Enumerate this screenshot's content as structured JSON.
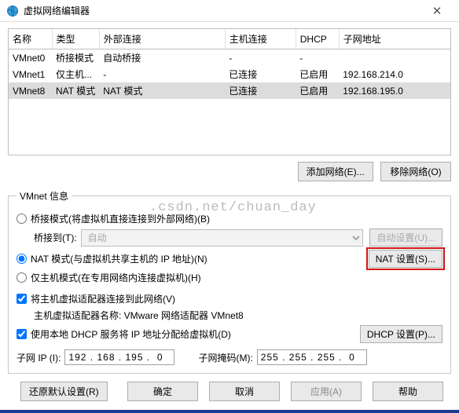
{
  "title": "虚拟网络编辑器",
  "close_icon": "✕",
  "globe_icon": "🌐",
  "watermark": ".csdn.net/chuan_day",
  "table": {
    "headers": [
      "名称",
      "类型",
      "外部连接",
      "主机连接",
      "DHCP",
      "子网地址"
    ],
    "rows": [
      {
        "name": "VMnet0",
        "type": "桥接模式",
        "ext": "自动桥接",
        "host": "-",
        "dhcp": "-",
        "subnet": ""
      },
      {
        "name": "VMnet1",
        "type": "仅主机...",
        "ext": "-",
        "host": "已连接",
        "dhcp": "已启用",
        "subnet": "192.168.214.0"
      },
      {
        "name": "VMnet8",
        "type": "NAT 模式",
        "ext": "NAT 模式",
        "host": "已连接",
        "dhcp": "已启用",
        "subnet": "192.168.195.0"
      }
    ],
    "selected_index": 2
  },
  "actions": {
    "add_network": "添加网络(E)...",
    "remove_network": "移除网络(O)"
  },
  "vmnet": {
    "legend": "VMnet 信息",
    "bridged_label": "桥接模式(将虚拟机直接连接到外部网络)(B)",
    "bridged_to": "桥接到(T):",
    "bridged_select": "自动",
    "auto_settings": "自动设置(U)...",
    "nat_label": "NAT 模式(与虚拟机共享主机的 IP 地址)(N)",
    "nat_settings": "NAT 设置(S)...",
    "hostonly_label": "仅主机模式(在专用网络内连接虚拟机)(H)",
    "connect_host_label": "将主机虚拟适配器连接到此网络(V)",
    "host_adapter_label": "主机虚拟适配器名称: VMware 网络适配器 VMnet8",
    "dhcp_label": "使用本地 DHCP 服务将 IP 地址分配给虚拟机(D)",
    "dhcp_settings": "DHCP 设置(P)...",
    "subnet_ip_label": "子网 IP (I):",
    "subnet_ip": "192 . 168 . 195 .  0",
    "subnet_mask_label": "子网掩码(M):",
    "subnet_mask": "255 . 255 . 255 .  0"
  },
  "footer": {
    "restore": "还原默认设置(R)",
    "ok": "确定",
    "cancel": "取消",
    "apply": "应用(A)",
    "help": "帮助"
  }
}
